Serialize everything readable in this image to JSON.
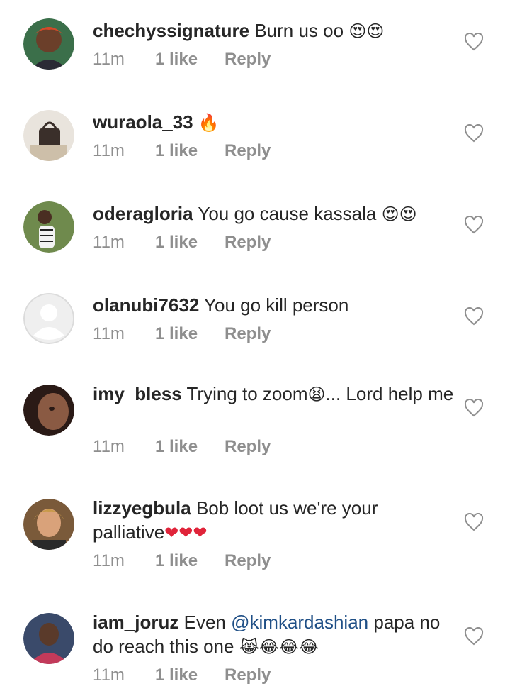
{
  "comments": [
    {
      "username": "chechyssignature",
      "text": "Burn us oo",
      "emoji": "😍😍",
      "time": "11m",
      "likes": "1 like",
      "reply": "Reply"
    },
    {
      "username": "wuraola_33",
      "text": "",
      "emoji": "🔥",
      "time": "11m",
      "likes": "1 like",
      "reply": "Reply"
    },
    {
      "username": "oderagloria",
      "text": "You go cause kassala",
      "emoji": "😍😍",
      "time": "11m",
      "likes": "1 like",
      "reply": "Reply"
    },
    {
      "username": "olanubi7632",
      "text": "You go kill person",
      "emoji": "",
      "time": "11m",
      "likes": "1 like",
      "reply": "Reply"
    },
    {
      "username": "imy_bless",
      "text_before": "Trying to zoom",
      "emoji": "😫",
      "text_after": "... Lord help me",
      "time": "11m",
      "likes": "1 like",
      "reply": "Reply"
    },
    {
      "username": "lizzyegbula",
      "text": "Bob loot us we're your palliative",
      "emoji": "❤❤❤",
      "time": "11m",
      "likes": "1 like",
      "reply": "Reply"
    },
    {
      "username": "iam_joruz",
      "text_before": "Even",
      "mention": "@kimkardashian",
      "text_after": "papa no do reach this one",
      "emoji": "😹😂😂😂",
      "time": "11m",
      "likes": "1 like",
      "reply": "Reply"
    }
  ],
  "icons": {
    "like": "heart-outline-icon",
    "avatar_placeholder": "default-avatar-icon"
  },
  "colors": {
    "text": "#262626",
    "muted": "#8e8e8e",
    "mention": "#1f4f86",
    "heart_stroke": "#8e8e8e"
  }
}
